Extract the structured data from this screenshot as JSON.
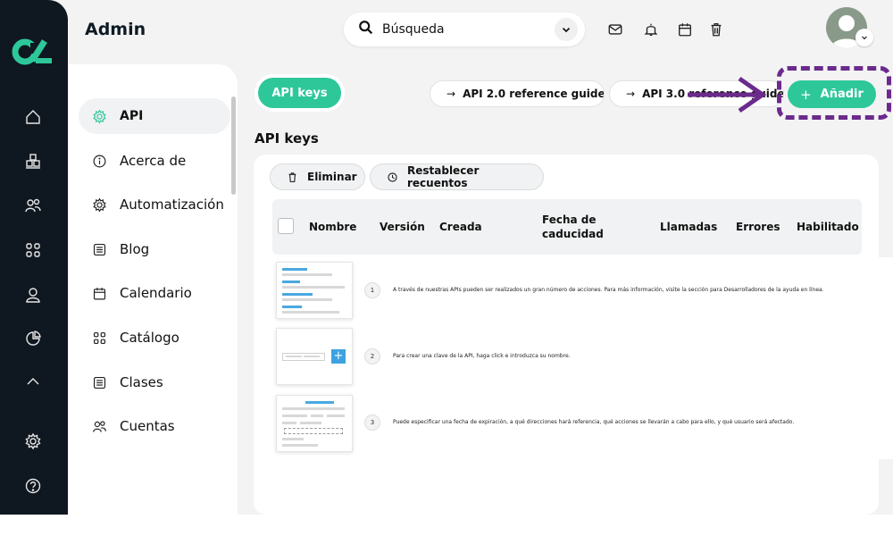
{
  "app": {
    "title": "Admin"
  },
  "search": {
    "text": "Búsqueda"
  },
  "header_icons": [
    "mail-icon",
    "bell-icon",
    "calendar-icon",
    "trash-icon"
  ],
  "rail_icons": [
    "home-icon",
    "boxes-icon",
    "users-icon",
    "grid-icon",
    "user-icon",
    "pie-chart-icon",
    "chevron-up-icon",
    "gear-icon",
    "help-icon"
  ],
  "sidebar": {
    "items": [
      {
        "label": "API",
        "icon": "gear-icon",
        "active": true
      },
      {
        "label": "Acerca de",
        "icon": "info-icon",
        "active": false
      },
      {
        "label": "Automatización",
        "icon": "gear-icon",
        "active": false
      },
      {
        "label": "Blog",
        "icon": "list-icon",
        "active": false
      },
      {
        "label": "Calendario",
        "icon": "calendar-icon",
        "active": false
      },
      {
        "label": "Catálogo",
        "icon": "grid-icon",
        "active": false
      },
      {
        "label": "Clases",
        "icon": "list-icon",
        "active": false
      },
      {
        "label": "Cuentas",
        "icon": "users-icon",
        "active": false
      }
    ]
  },
  "main": {
    "tab": "API keys",
    "ref_buttons": [
      "API 2.0 reference guide",
      "API 3.0 reference guide"
    ],
    "add_label": "Añadir",
    "section_title": "API keys",
    "actions": {
      "delete": "Eliminar",
      "reset": "Restablecer recuentos"
    },
    "columns": [
      "Nombre",
      "Versión",
      "Creada",
      "Fecha de caducidad",
      "Llamadas",
      "Errores",
      "Habilitado"
    ]
  },
  "instructions": [
    {
      "n": "1",
      "text": "A través de nuestras APIs pueden ser realizados un gran número de acciones. Para más información, visite la sección para Desarrolladores de la ayuda en línea."
    },
    {
      "n": "2",
      "text": "Para crear una clave de la API, haga click e introduzca su nombre."
    },
    {
      "n": "3",
      "text": "Puede especificar una fecha de expiración, a qué direcciones hará referencia, qué acciones se llevarán a cabo para ello, y qué usuario será afectado."
    }
  ],
  "colors": {
    "accent": "#2ec79a",
    "rail": "#0f1720",
    "annotation": "#6b2a8c"
  }
}
